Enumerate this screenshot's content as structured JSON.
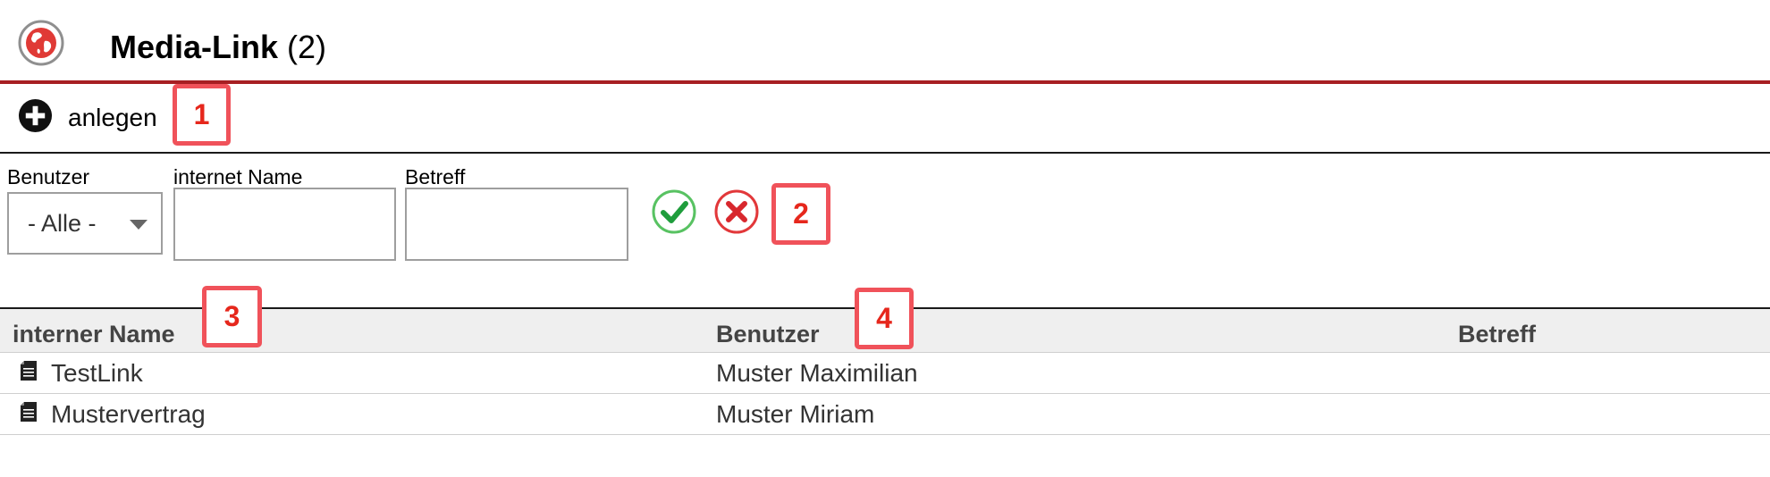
{
  "header": {
    "app_icon": "globe-icon",
    "title": "Media-Link",
    "count": "(2)",
    "accent_color": "#a71f23"
  },
  "toolbar": {
    "add_icon": "plus-circle-icon",
    "add_label": "anlegen"
  },
  "filters": {
    "user": {
      "label": "Benutzer",
      "selected": "- Alle -"
    },
    "internal_name": {
      "label": "internet Name",
      "value": ""
    },
    "subject": {
      "label": "Betreff",
      "value": ""
    },
    "apply_icon": "checkmark-icon",
    "reset_icon": "close-circle-icon"
  },
  "callouts": [
    "1",
    "2",
    "3",
    "4"
  ],
  "table": {
    "columns": [
      "interner Name",
      "Benutzer",
      "Betreff"
    ],
    "rows": [
      {
        "icon": "document-icon",
        "name": "TestLink",
        "user": "Muster Maximilian",
        "subject": ""
      },
      {
        "icon": "document-icon",
        "name": "Mustervertrag",
        "user": "Muster Miriam",
        "subject": ""
      }
    ]
  }
}
